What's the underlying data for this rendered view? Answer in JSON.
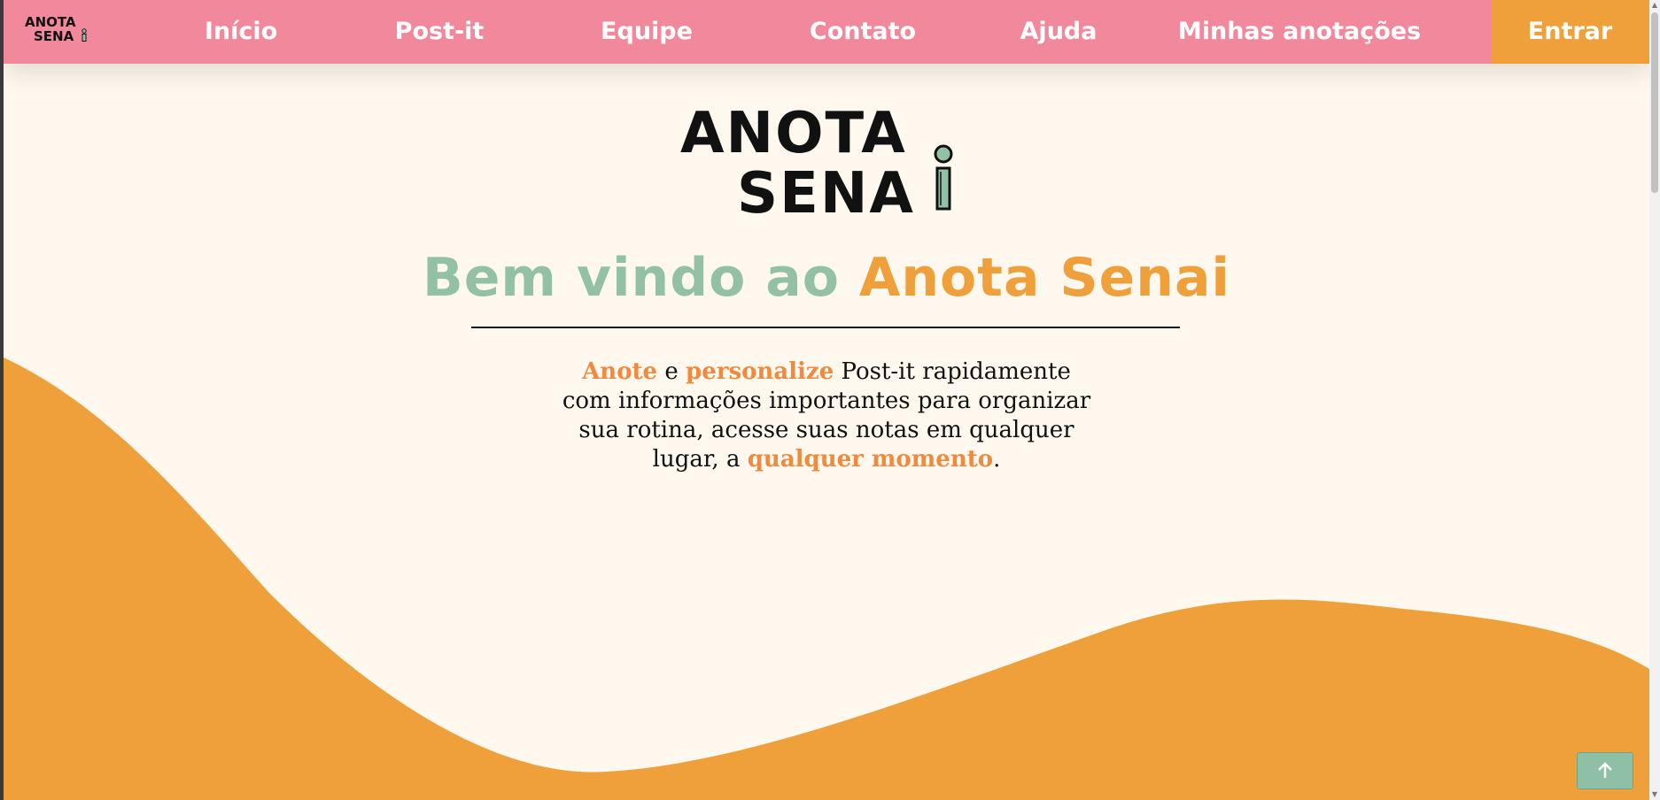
{
  "nav": {
    "logo_line1": "ANOTA",
    "logo_line2": "SENA",
    "items": [
      {
        "label": "Início"
      },
      {
        "label": "Post-it"
      },
      {
        "label": "Equipe"
      },
      {
        "label": "Contato"
      },
      {
        "label": "Ajuda"
      },
      {
        "label": "Minhas anotações"
      }
    ],
    "login_label": "Entrar"
  },
  "hero": {
    "logo_line1": "ANOTA",
    "logo_line2": "SENA",
    "welcome_part1": "Bem vindo ao",
    "welcome_part2": "Anota Senai",
    "desc": {
      "hl1": "Anote",
      "t1": " e ",
      "hl2": "personalize",
      "t2": " Post-it rapidamente com informações importantes para organizar sua rotina, acesse suas notas em qualquer lugar, a ",
      "hl3": "qualquer momento",
      "t3": "."
    }
  },
  "colors": {
    "navbar": "#f2889b",
    "accent_orange": "#f0a03a",
    "accent_green": "#92c1a6",
    "background": "#fff8ee",
    "highlight_text": "#ef8a3e"
  },
  "icons": {
    "scroll_top": "arrow-up-icon",
    "logo_pencil": "pencil-icon"
  }
}
